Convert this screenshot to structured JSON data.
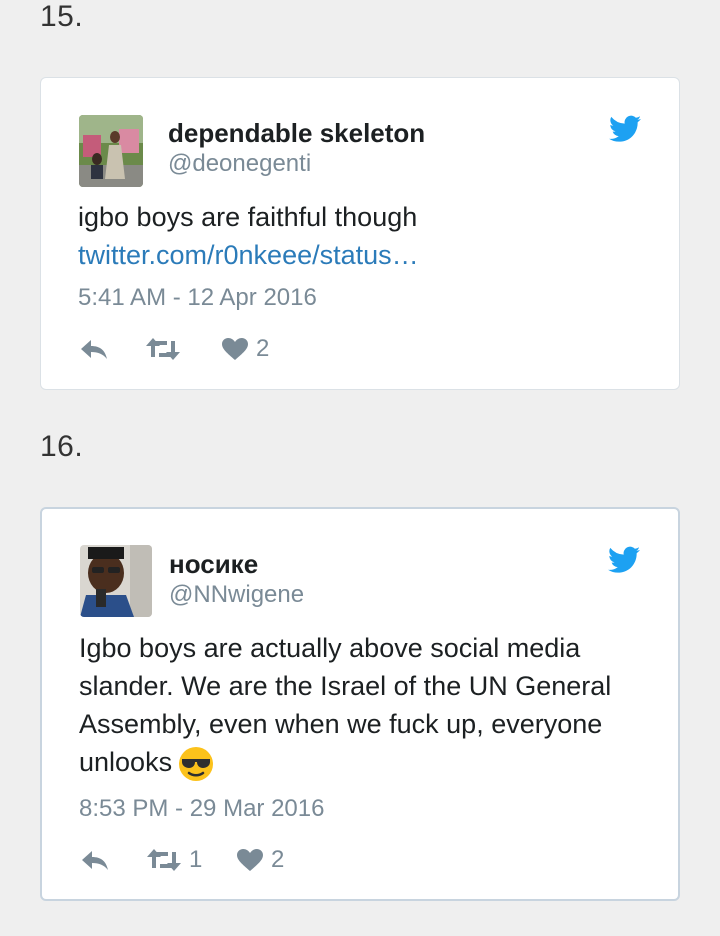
{
  "tweets": [
    {
      "number": "15.",
      "name": "dependable skeleton",
      "handle": "@deonegenti",
      "text": "igbo boys are faithful though",
      "link": "twitter.com/r0nkeee/status…",
      "timestamp": "5:41 AM - 12 Apr 2016",
      "retweets": "",
      "likes": "2"
    },
    {
      "number": "16.",
      "name": "носике",
      "handle": "@NNwigene",
      "text": "Igbo boys are actually above social media slander. We are the Israel of the UN General Assembly, even when we fuck up, everyone unlooks",
      "emoji": "smiling-face-with-sunglasses",
      "timestamp": "8:53 PM - 29 Mar 2016",
      "retweets": "1",
      "likes": "2"
    }
  ],
  "colors": {
    "background": "#efefef",
    "card": "#ffffff",
    "link": "#2b7bb9",
    "twitter_blue": "#1da1f2",
    "muted": "#7a8a96",
    "text": "#1c2022"
  }
}
